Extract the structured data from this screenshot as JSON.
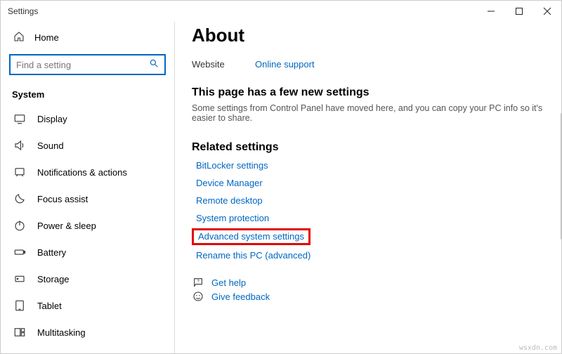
{
  "window": {
    "title": "Settings"
  },
  "sidebar": {
    "home_label": "Home",
    "search_placeholder": "Find a setting",
    "group_title": "System",
    "items": [
      {
        "label": "Display"
      },
      {
        "label": "Sound"
      },
      {
        "label": "Notifications & actions"
      },
      {
        "label": "Focus assist"
      },
      {
        "label": "Power & sleep"
      },
      {
        "label": "Battery"
      },
      {
        "label": "Storage"
      },
      {
        "label": "Tablet"
      },
      {
        "label": "Multitasking"
      }
    ]
  },
  "main": {
    "heading": "About",
    "website_label": "Website",
    "website_link": "Online support",
    "new_settings_heading": "This page has a few new settings",
    "new_settings_sub": "Some settings from Control Panel have moved here, and you can copy your PC info so it's easier to share.",
    "related_heading": "Related settings",
    "related_links": {
      "bitlocker": "BitLocker settings",
      "device_manager": "Device Manager",
      "remote_desktop": "Remote desktop",
      "system_protection": "System protection",
      "advanced_system": "Advanced system settings",
      "rename_pc": "Rename this PC (advanced)"
    },
    "help": {
      "get_help": "Get help",
      "give_feedback": "Give feedback"
    }
  },
  "watermark": "wsxdn.com"
}
